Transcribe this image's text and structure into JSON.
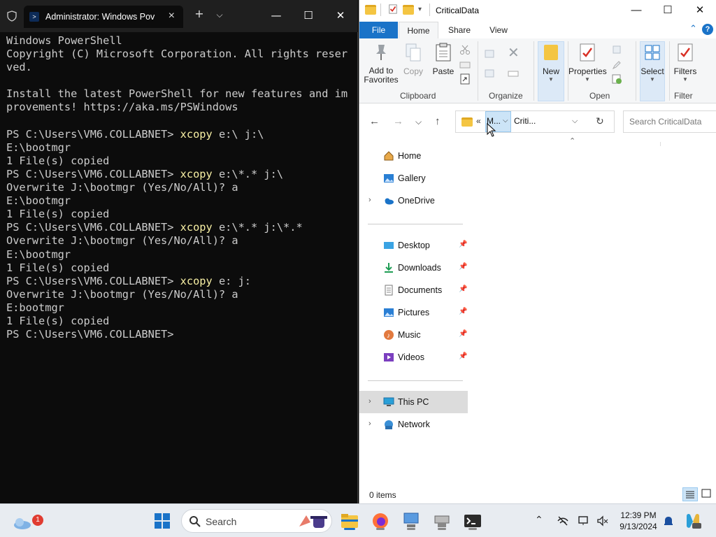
{
  "terminal": {
    "tab_title": "Administrator: Windows Pov",
    "lines": [
      {
        "t": "Windows PowerShell"
      },
      {
        "t": "Copyright (C) Microsoft Corporation. All rights reser"
      },
      {
        "t": "ved."
      },
      {
        "t": ""
      },
      {
        "t": "Install the latest PowerShell for new features and im"
      },
      {
        "t": "provements! https://aka.ms/PSWindows"
      },
      {
        "t": ""
      },
      {
        "t": "PS C:\\Users\\VM6.COLLABNET> ",
        "c": "xcopy",
        "r": " e:\\ j:\\"
      },
      {
        "t": "E:\\bootmgr"
      },
      {
        "t": "1 File(s) copied"
      },
      {
        "t": "PS C:\\Users\\VM6.COLLABNET> ",
        "c": "xcopy",
        "r": " e:\\*.* j:\\"
      },
      {
        "t": "Overwrite J:\\bootmgr (Yes/No/All)? a"
      },
      {
        "t": "E:\\bootmgr"
      },
      {
        "t": "1 File(s) copied"
      },
      {
        "t": "PS C:\\Users\\VM6.COLLABNET> ",
        "c": "xcopy",
        "r": " e:\\*.* j:\\*.*"
      },
      {
        "t": "Overwrite J:\\bootmgr (Yes/No/All)? a"
      },
      {
        "t": "E:\\bootmgr"
      },
      {
        "t": "1 File(s) copied"
      },
      {
        "t": "PS C:\\Users\\VM6.COLLABNET> ",
        "c": "xcopy",
        "r": " e: j:"
      },
      {
        "t": "Overwrite J:\\bootmgr (Yes/No/All)? a"
      },
      {
        "t": "E:bootmgr"
      },
      {
        "t": "1 File(s) copied"
      },
      {
        "t": "PS C:\\Users\\VM6.COLLABNET>"
      }
    ]
  },
  "explorer": {
    "title": "CriticalData",
    "ribbon_tabs": {
      "file": "File",
      "home": "Home",
      "share": "Share",
      "view": "View"
    },
    "ribbon": {
      "add_to_favorites": "Add to\nFavorites",
      "copy": "Copy",
      "paste": "Paste",
      "new": "New",
      "properties": "Properties",
      "select": "Select",
      "filters": "Filters",
      "groups": {
        "clipboard": "Clipboard",
        "organize": "Organize",
        "open": "Open",
        "filter": "Filter"
      }
    },
    "address": {
      "overflow": "«",
      "crumb1": "M...",
      "crumb2": "Criti..."
    },
    "search_placeholder": "Search CriticalData",
    "nav_items": {
      "home": "Home",
      "gallery": "Gallery",
      "onedrive": "OneDrive",
      "desktop": "Desktop",
      "downloads": "Downloads",
      "documents": "Documents",
      "pictures": "Pictures",
      "music": "Music",
      "videos": "Videos",
      "thispc": "This PC",
      "network": "Network"
    },
    "status": "0 items"
  },
  "taskbar": {
    "search_label": "Search",
    "time": "12:39 PM",
    "date": "9/13/2024",
    "weather_badge": "1"
  }
}
